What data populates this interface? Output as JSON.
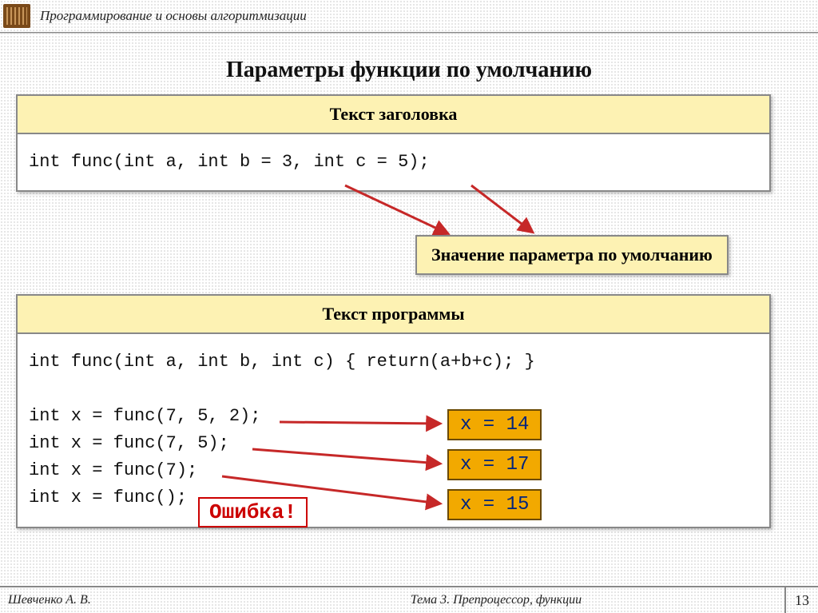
{
  "header": {
    "course_title": "Программирование и основы алгоритмизации"
  },
  "slide_title": "Параметры функции по умолчанию",
  "box1": {
    "title": "Текст заголовка",
    "code": "int func(int a, int b = 3, int c = 5);"
  },
  "callout": "Значение параметра по умолчанию",
  "box2": {
    "title": "Текст программы",
    "code": "int func(int a, int b, int c) { return(a+b+c); }\n\nint x = func(7, 5, 2);\nint x = func(7, 5);\nint x = func(7);\nint x = func();"
  },
  "results": {
    "r1": "x = 14",
    "r2": "x = 17",
    "r3": "x = 15"
  },
  "error_label": "Ошибка!",
  "footer": {
    "author": "Шевченко А. В.",
    "topic": "Тема 3. Препроцессор, функции",
    "page": "13"
  }
}
